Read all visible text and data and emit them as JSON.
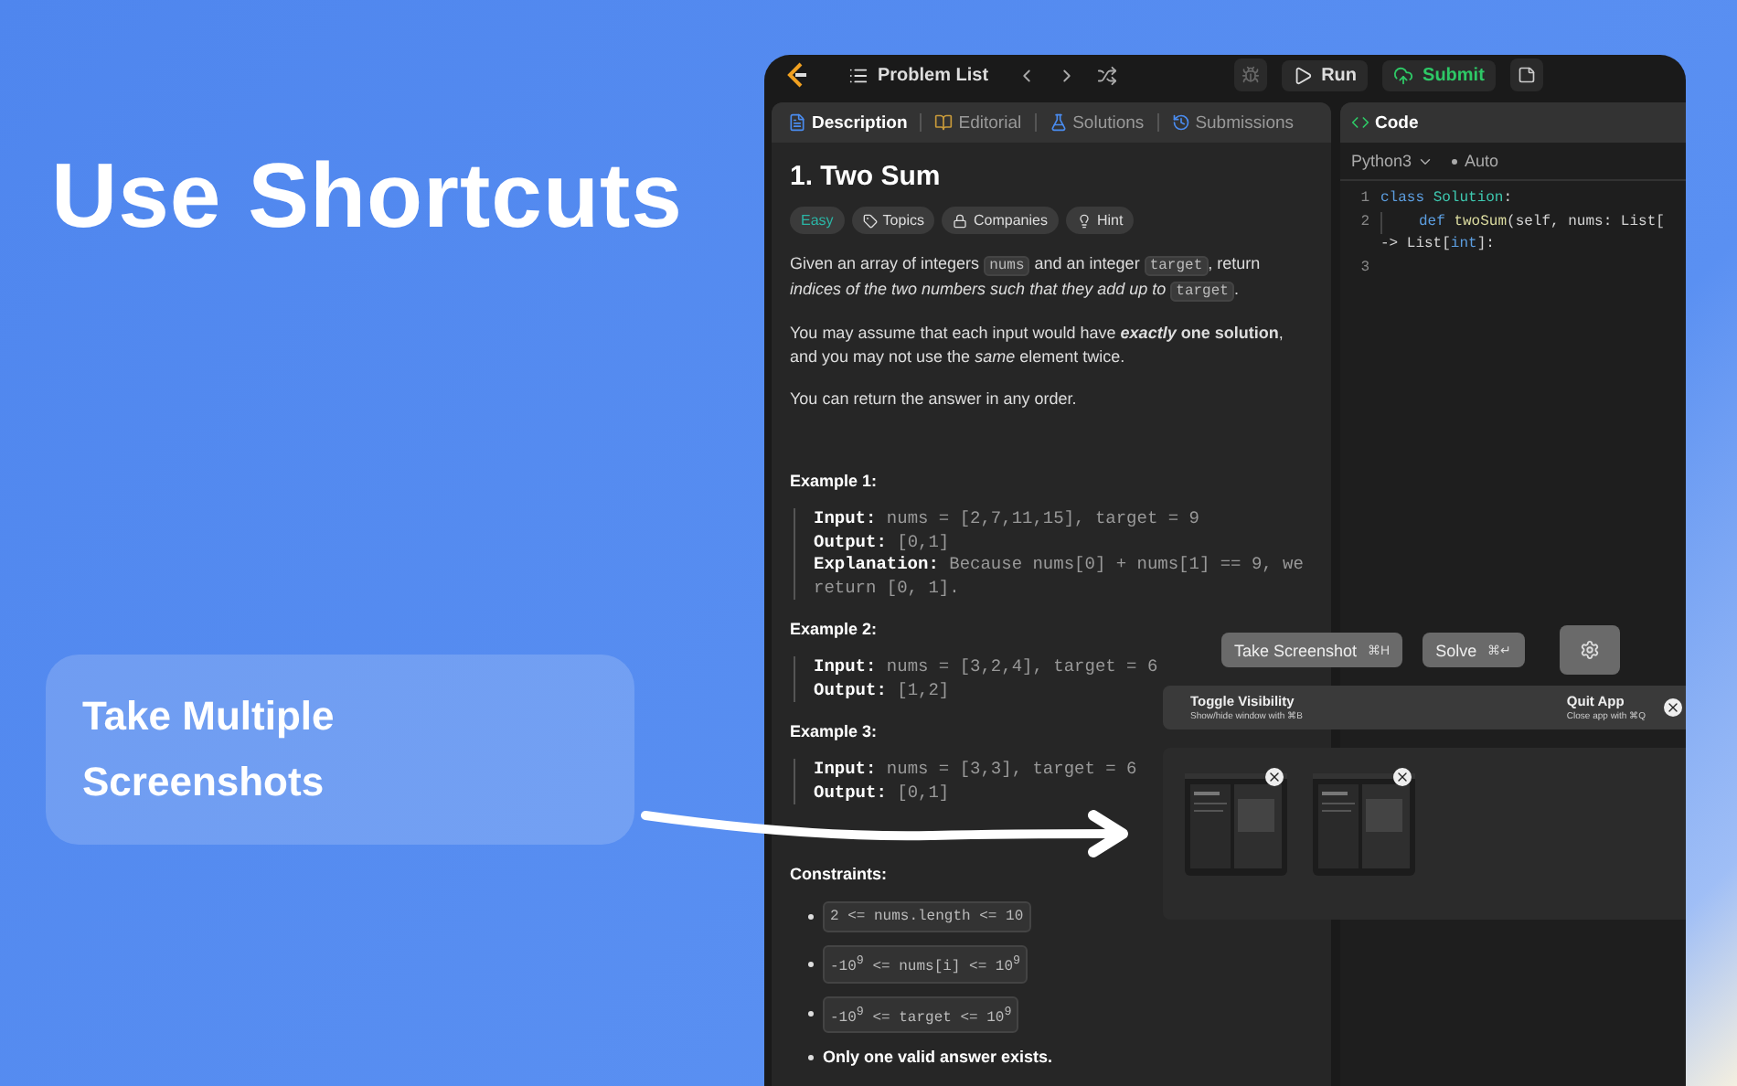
{
  "headline": "Use Shortcuts",
  "feature_card": {
    "text": "Take Multiple Screenshots"
  },
  "app": {
    "toolbar": {
      "problem_list": "Problem List",
      "run": "Run",
      "submit": "Submit"
    },
    "tabs": [
      {
        "label": "Description",
        "selected": true
      },
      {
        "label": "Editorial",
        "selected": false
      },
      {
        "label": "Solutions",
        "selected": false
      },
      {
        "label": "Submissions",
        "selected": false
      }
    ],
    "problem": {
      "title": "1. Two Sum",
      "difficulty": {
        "label": "Easy",
        "color": "#2bb5a5"
      },
      "tags": [
        {
          "label": "Topics"
        },
        {
          "label": "Companies"
        },
        {
          "label": "Hint"
        }
      ],
      "paragraphs": [
        [
          {
            "kind": "text",
            "text": "Given an array of integers "
          },
          {
            "kind": "code",
            "text": "nums"
          },
          {
            "kind": "text",
            "text": " and an integer "
          },
          {
            "kind": "code",
            "text": "target"
          },
          {
            "kind": "text",
            "text": ", return *indices of the two numbers such that they add up to* "
          },
          {
            "kind": "code",
            "text": "target"
          },
          {
            "kind": "text",
            "text": "."
          }
        ],
        [
          {
            "kind": "text",
            "text": "You may assume that each input would have ***exactly* one solution**, and you may not use the *same* element twice."
          }
        ],
        [
          {
            "kind": "text",
            "text": "You can return the answer in any order."
          }
        ]
      ],
      "examples": [
        {
          "title": "Example 1:",
          "lines": [
            {
              "label": "Input:",
              "value": "nums = [2,7,11,15], target = 9"
            },
            {
              "label": "Output:",
              "value": "[0,1]"
            },
            {
              "label": "Explanation:",
              "value": "Because nums[0] + nums[1] == 9, we return [0, 1]."
            }
          ]
        },
        {
          "title": "Example 2:",
          "lines": [
            {
              "label": "Input:",
              "value": "nums = [3,2,4], target = 6"
            },
            {
              "label": "Output:",
              "value": "[1,2]"
            }
          ]
        },
        {
          "title": "Example 3:",
          "lines": [
            {
              "label": "Input:",
              "value": "nums = [3,3], target = 6"
            },
            {
              "label": "Output:",
              "value": "[0,1]"
            }
          ]
        }
      ],
      "constraints_title": "Constraints:",
      "constraints": [
        {
          "kind": "code",
          "text": "2 <= nums.length <= 10"
        },
        {
          "kind": "code",
          "text": "-10$^{9}$ <= nums[i] <= 10$^{9}$"
        },
        {
          "kind": "code",
          "text": "-10$^{9}$ <= target <= 10$^{9}$"
        },
        {
          "kind": "text",
          "text": "Only one valid answer exists."
        }
      ]
    },
    "editor": {
      "title": "Code",
      "language": "Python3",
      "mode": "Auto",
      "lines": [
        {
          "number": "1",
          "tokens": [
            {
              "kind": "keyword",
              "text": "class "
            },
            {
              "kind": "type",
              "text": "Solution"
            },
            {
              "kind": "plain",
              "text": ":"
            }
          ]
        },
        {
          "number": "2",
          "indent": true,
          "tokens": [
            {
              "kind": "keyword",
              "text": "def "
            },
            {
              "kind": "function",
              "text": "twoSum"
            },
            {
              "kind": "plain",
              "text": "(self, nums: List["
            }
          ]
        },
        {
          "tokens": [
            {
              "kind": "plain",
              "text": "-> List["
            },
            {
              "kind": "keyword",
              "text": "int"
            },
            {
              "kind": "plain",
              "text": "]:"
            }
          ]
        },
        {
          "number": "3"
        }
      ]
    },
    "overlay": {
      "buttons": [
        {
          "label": "Take Screenshot",
          "shortcut": "⌘H"
        },
        {
          "label": "Solve",
          "shortcut": "⌘↵"
        }
      ],
      "shortcuts": [
        {
          "title": "Toggle Visibility",
          "hint": "Show/hide window with ⌘B"
        },
        {
          "title": "Quit App",
          "hint": "Close app with ⌘Q"
        }
      ],
      "screenshots": [
        {
          "removable": true
        },
        {
          "removable": true
        }
      ]
    }
  }
}
